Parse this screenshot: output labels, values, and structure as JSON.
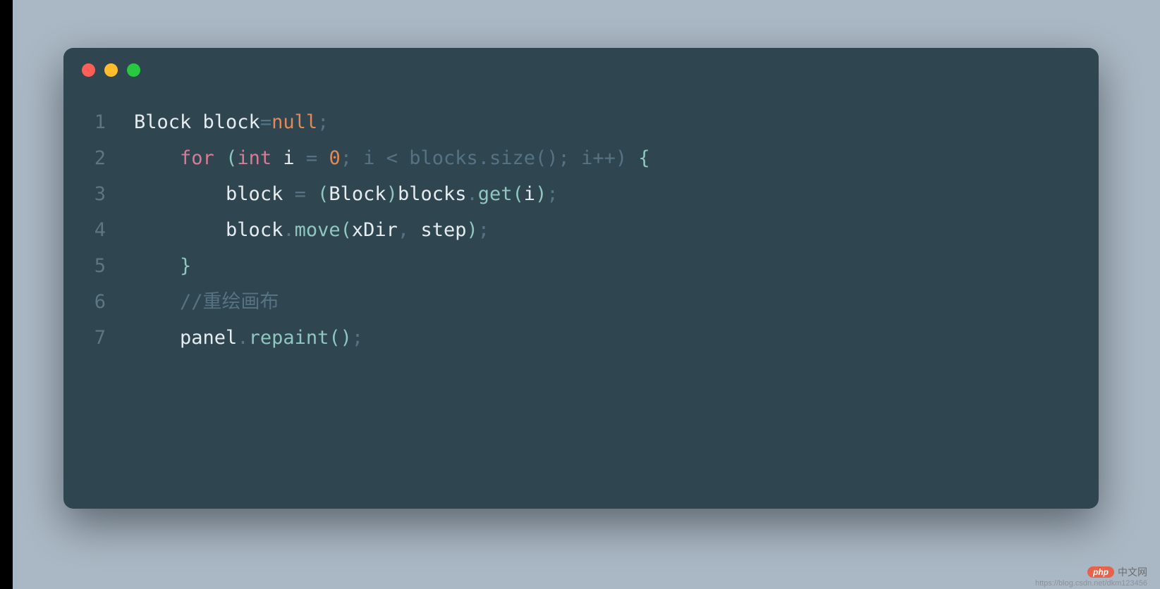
{
  "window": {
    "dots": [
      "red",
      "yellow",
      "green"
    ]
  },
  "code": {
    "lines": [
      {
        "n": "1",
        "indent": "",
        "tokens": [
          {
            "t": "Block block",
            "c": "ident"
          },
          {
            "t": "=",
            "c": "assign"
          },
          {
            "t": "null",
            "c": "nullkw"
          },
          {
            "t": ";",
            "c": "punct"
          }
        ]
      },
      {
        "n": "2",
        "indent": "    ",
        "tokens": [
          {
            "t": "for",
            "c": "kw"
          },
          {
            "t": " ",
            "c": "ident"
          },
          {
            "t": "(",
            "c": "paren"
          },
          {
            "t": "int",
            "c": "kw"
          },
          {
            "t": " i ",
            "c": "ident"
          },
          {
            "t": "=",
            "c": "assign"
          },
          {
            "t": " ",
            "c": "ident"
          },
          {
            "t": "0",
            "c": "num"
          },
          {
            "t": "; i < blocks.size(); i++) ",
            "c": "dim"
          },
          {
            "t": "{",
            "c": "brace"
          }
        ]
      },
      {
        "n": "3",
        "indent": "        ",
        "tokens": [
          {
            "t": "block ",
            "c": "ident"
          },
          {
            "t": "=",
            "c": "assign"
          },
          {
            "t": " ",
            "c": "ident"
          },
          {
            "t": "(",
            "c": "paren"
          },
          {
            "t": "Block",
            "c": "ident"
          },
          {
            "t": ")",
            "c": "paren"
          },
          {
            "t": "blocks",
            "c": "ident"
          },
          {
            "t": ".",
            "c": "punct"
          },
          {
            "t": "get",
            "c": "fn"
          },
          {
            "t": "(",
            "c": "paren"
          },
          {
            "t": "i",
            "c": "ident"
          },
          {
            "t": ")",
            "c": "paren"
          },
          {
            "t": ";",
            "c": "punct"
          }
        ]
      },
      {
        "n": "4",
        "indent": "        ",
        "tokens": [
          {
            "t": "block",
            "c": "ident"
          },
          {
            "t": ".",
            "c": "punct"
          },
          {
            "t": "move",
            "c": "fn"
          },
          {
            "t": "(",
            "c": "paren"
          },
          {
            "t": "xDir",
            "c": "ident"
          },
          {
            "t": ",",
            "c": "punct"
          },
          {
            "t": " step",
            "c": "ident"
          },
          {
            "t": ")",
            "c": "paren"
          },
          {
            "t": ";",
            "c": "punct"
          }
        ]
      },
      {
        "n": "5",
        "indent": "    ",
        "tokens": [
          {
            "t": "}",
            "c": "brace"
          }
        ]
      },
      {
        "n": "6",
        "indent": "    ",
        "tokens": [
          {
            "t": "//重绘画布",
            "c": "cmt"
          }
        ]
      },
      {
        "n": "7",
        "indent": "    ",
        "tokens": [
          {
            "t": "panel",
            "c": "ident"
          },
          {
            "t": ".",
            "c": "punct"
          },
          {
            "t": "repaint",
            "c": "fn"
          },
          {
            "t": "()",
            "c": "paren"
          },
          {
            "t": ";",
            "c": "punct"
          }
        ]
      }
    ]
  },
  "watermark": {
    "pill": "php",
    "label": "中文网",
    "url": "https://blog.csdn.net/dkm123456"
  }
}
